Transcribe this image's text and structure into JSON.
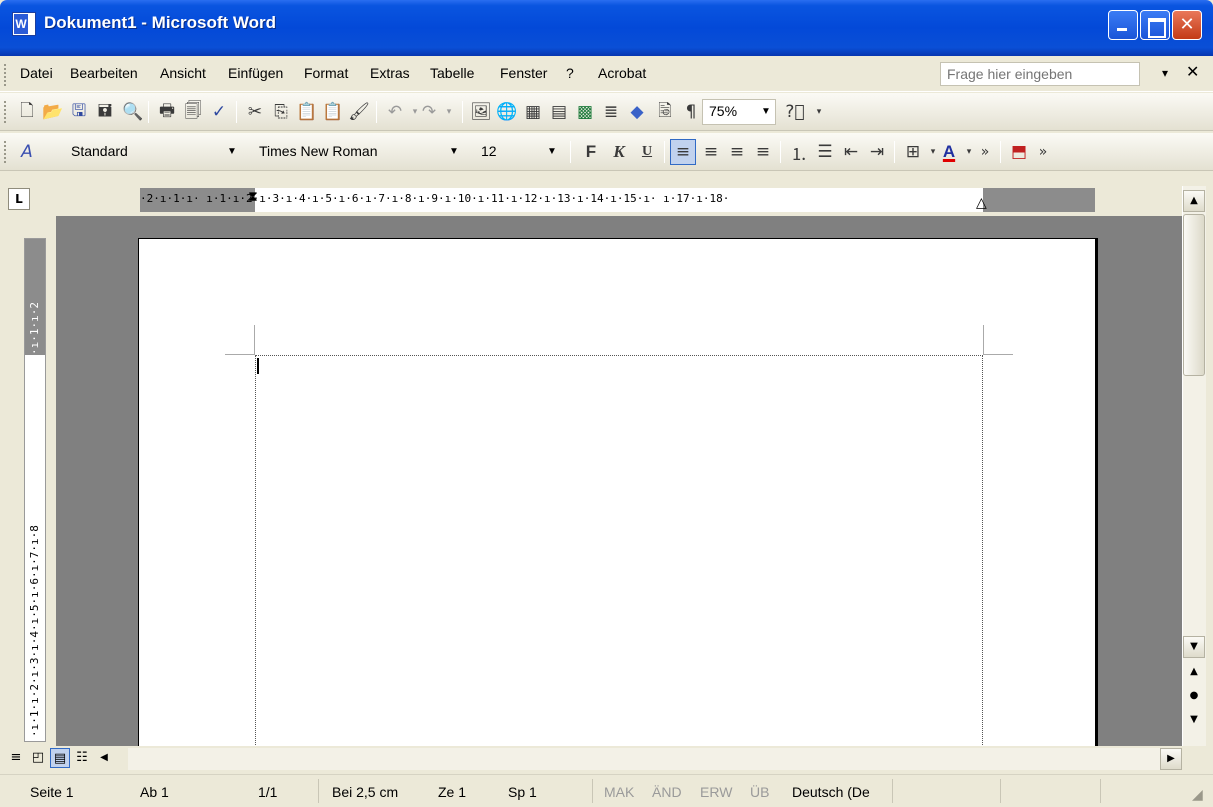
{
  "window": {
    "title": "Dokument1 - Microsoft Word",
    "app_icon": "W",
    "controls": [
      "minimize-icon",
      "maximize-icon",
      "close-icon"
    ]
  },
  "menubar": {
    "items": [
      "Datei",
      "Bearbeiten",
      "Ansicht",
      "Einfügen",
      "Format",
      "Extras",
      "Tabelle",
      "Fenster",
      "?",
      "Acrobat"
    ],
    "ask_placeholder": "Frage hier eingeben",
    "ask_caret": "▾",
    "close_doc": "✕"
  },
  "standard_toolbar": {
    "zoom": "75%",
    "icons": [
      "new-icon",
      "open-icon",
      "save-icon",
      "permission-icon",
      "research-icon",
      "print-icon",
      "print-preview-icon",
      "spelling-icon",
      "cut-icon",
      "copy-icon",
      "paste-icon",
      "paste-special-icon",
      "format-painter-icon",
      "undo-icon",
      "redo-icon",
      "insert-drawing-icon",
      "web-icon",
      "table-draw-icon",
      "insert-table-icon",
      "insert-excel-icon",
      "columns-icon",
      "drawing-icon",
      "document-map-icon",
      "show-formatting-icon",
      "help-icon"
    ]
  },
  "formatting_toolbar": {
    "style": "Standard",
    "font": "Times New Roman",
    "size": "12",
    "bold": "F",
    "italic": "K",
    "underline": "U",
    "icons": [
      "styles-icon",
      "align-left-icon",
      "center-icon",
      "align-right-icon",
      "justify-icon",
      "numbering-icon",
      "bullets-icon",
      "decrease-indent-icon",
      "increase-indent-icon",
      "border-icon",
      "font-color-icon",
      "more-icon",
      "acrobat-pdf-icon"
    ]
  },
  "ruler": {
    "tab_selector": "L",
    "horizontal_text": "·2·ı·1·ı·  ı·1·ı·2·ı·3·ı·4·ı·5·ı·6·ı·7·ı·8·ı·9·ı·10·ı·11·ı·12·ı·13·ı·14·ı·15·ı·  ı·17·ı·18·",
    "vertical_top": "·ı·1·ı·2",
    "vertical_body": "·ı·1·ı·2·ı·3·ı·4·ı·5·ı·6·ı·7·ı·8"
  },
  "statusbar": {
    "seite": "Seite 1",
    "ab": "Ab 1",
    "pages": "1/1",
    "bei": "Bei 2,5 cm",
    "ze": "Ze 1",
    "sp": "Sp 1",
    "mak": "MAK",
    "aend": "ÄND",
    "erw": "ERW",
    "ueb": "ÜB",
    "language": "Deutsch (De"
  },
  "colors": {
    "titlebar": "#0349d8",
    "chrome": "#ece9d8",
    "workspace": "#808080",
    "active_button": "#c1d2ee"
  }
}
